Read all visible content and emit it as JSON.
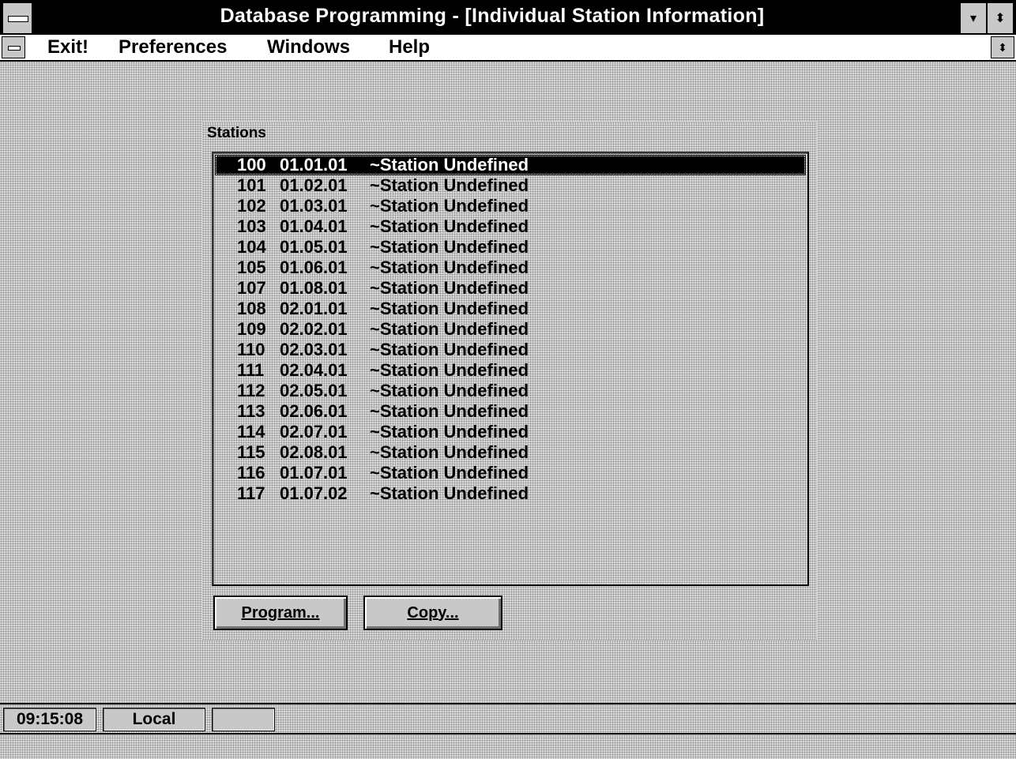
{
  "window": {
    "title": "Database Programming - [Individual Station Information]",
    "minimize_icon": "▾",
    "restore_icon": "⬍"
  },
  "menu": {
    "items": [
      "Exit!",
      "Preferences",
      "Windows",
      "Help"
    ],
    "restore_icon": "⬍"
  },
  "stations": {
    "label": "Stations",
    "selected_index": 0,
    "rows": [
      {
        "num": "100",
        "port": "01.01.01",
        "name": "~Station Undefined"
      },
      {
        "num": "101",
        "port": "01.02.01",
        "name": "~Station Undefined"
      },
      {
        "num": "102",
        "port": "01.03.01",
        "name": "~Station Undefined"
      },
      {
        "num": "103",
        "port": "01.04.01",
        "name": "~Station Undefined"
      },
      {
        "num": "104",
        "port": "01.05.01",
        "name": "~Station Undefined"
      },
      {
        "num": "105",
        "port": "01.06.01",
        "name": "~Station Undefined"
      },
      {
        "num": "107",
        "port": "01.08.01",
        "name": "~Station Undefined"
      },
      {
        "num": "108",
        "port": "02.01.01",
        "name": "~Station Undefined"
      },
      {
        "num": "109",
        "port": "02.02.01",
        "name": "~Station Undefined"
      },
      {
        "num": "110",
        "port": "02.03.01",
        "name": "~Station Undefined"
      },
      {
        "num": "111",
        "port": "02.04.01",
        "name": "~Station Undefined"
      },
      {
        "num": "112",
        "port": "02.05.01",
        "name": "~Station Undefined"
      },
      {
        "num": "113",
        "port": "02.06.01",
        "name": "~Station Undefined"
      },
      {
        "num": "114",
        "port": "02.07.01",
        "name": "~Station Undefined"
      },
      {
        "num": "115",
        "port": "02.08.01",
        "name": "~Station Undefined"
      },
      {
        "num": "116",
        "port": "01.07.01",
        "name": "~Station Undefined"
      },
      {
        "num": "117",
        "port": "01.07.02",
        "name": "~Station Undefined"
      }
    ],
    "program_button": "Program...",
    "copy_button": "Copy..."
  },
  "status": {
    "time": "09:15:08",
    "mode": "Local",
    "extra": ""
  }
}
